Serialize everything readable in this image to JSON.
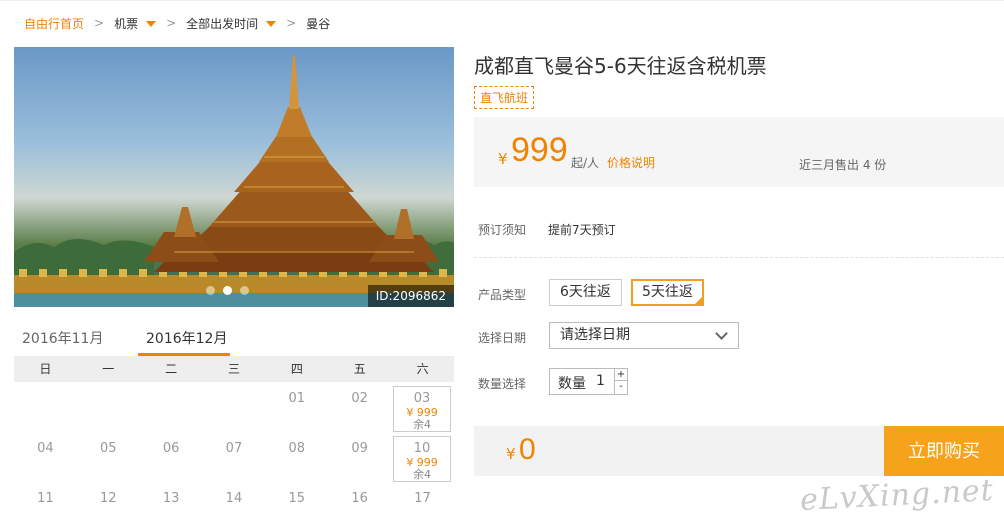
{
  "breadcrumb": {
    "home": "自由行首页",
    "sep": ">",
    "flight": "机票",
    "time": "全部出发时间",
    "city": "曼谷"
  },
  "photo": {
    "id_label": "ID:2096862",
    "dots": 3,
    "active_dot": 1
  },
  "calendar": {
    "tabs": [
      "2016年11月",
      "2016年12月"
    ],
    "active_tab": 1,
    "weekdays": [
      "日",
      "一",
      "二",
      "三",
      "四",
      "五",
      "六"
    ],
    "rows": [
      [
        {
          "d": ""
        },
        {
          "d": ""
        },
        {
          "d": ""
        },
        {
          "d": ""
        },
        {
          "d": "01"
        },
        {
          "d": "02"
        },
        {
          "d": "03",
          "price": "¥ 999",
          "left": "余4"
        }
      ],
      [
        {
          "d": "04"
        },
        {
          "d": "05"
        },
        {
          "d": "06"
        },
        {
          "d": "07"
        },
        {
          "d": "08"
        },
        {
          "d": "09"
        },
        {
          "d": "10",
          "price": "¥ 999",
          "left": "余4"
        }
      ],
      [
        {
          "d": "11"
        },
        {
          "d": "12"
        },
        {
          "d": "13"
        },
        {
          "d": "14"
        },
        {
          "d": "15"
        },
        {
          "d": "16"
        },
        {
          "d": "17"
        }
      ]
    ]
  },
  "product": {
    "title": "成都直飞曼谷5-6天往返含税机票",
    "tag": "直飞航班",
    "price": {
      "yen": "¥",
      "value": "999",
      "unit": "起/人",
      "note": "价格说明",
      "sold": "近三月售出 4 份"
    },
    "notice_label": "预订须知",
    "notice_value": "提前7天预订",
    "type_label": "产品类型",
    "options": [
      "6天往返",
      "5天往返"
    ],
    "selected_option": 1,
    "date_label": "选择日期",
    "date_placeholder": "请选择日期",
    "qty_label_row": "数量选择",
    "qty_field_label": "数量",
    "qty_value": "1",
    "qty_plus": "+",
    "qty_minus": "-"
  },
  "total": {
    "yen": "¥",
    "value": "0"
  },
  "buy_button": "立即购买",
  "watermark": "eLvXing.net",
  "colors": {
    "accent": "#f08300",
    "buy": "#f7a21b"
  }
}
